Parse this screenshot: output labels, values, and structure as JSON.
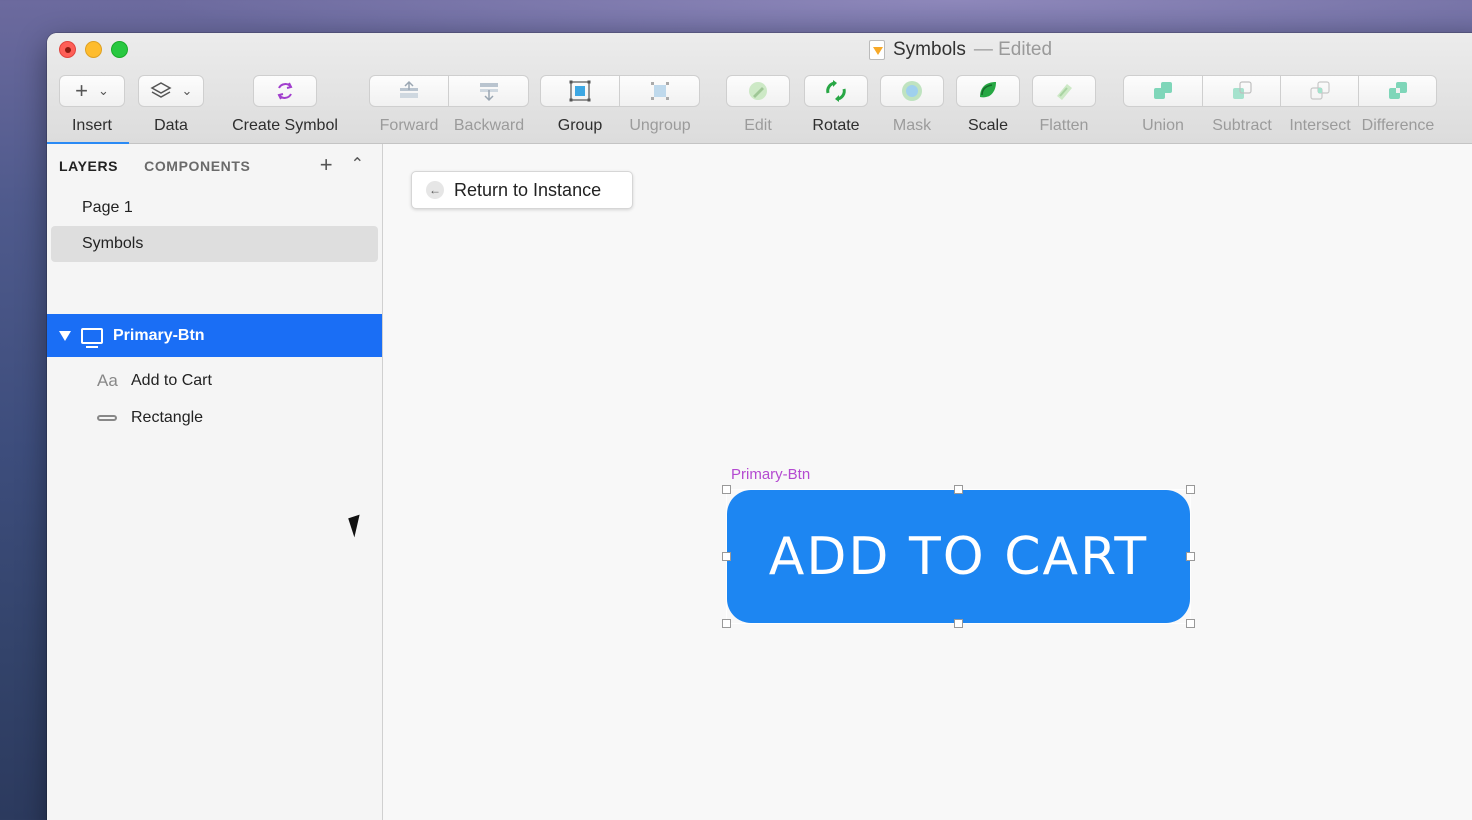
{
  "window": {
    "title": "Symbols",
    "title_status": "— Edited"
  },
  "toolbar": {
    "insert": "Insert",
    "data": "Data",
    "create_symbol": "Create Symbol",
    "forward": "Forward",
    "backward": "Backward",
    "group": "Group",
    "ungroup": "Ungroup",
    "edit": "Edit",
    "rotate": "Rotate",
    "mask": "Mask",
    "scale": "Scale",
    "flatten": "Flatten",
    "union": "Union",
    "subtract": "Subtract",
    "intersect": "Intersect",
    "difference": "Difference"
  },
  "sidebar": {
    "tabs": {
      "layers": "LAYERS",
      "components": "COMPONENTS"
    },
    "pages": [
      "Page 1",
      "Symbols"
    ],
    "selected_page": "Symbols",
    "layers": {
      "artboard": "Primary-Btn",
      "children": [
        {
          "icon": "text-layer-icon",
          "glyph": "Aa",
          "label": "Add to Cart"
        },
        {
          "icon": "rectangle-layer-icon",
          "label": "Rectangle"
        }
      ]
    }
  },
  "canvas": {
    "return_button": "Return to Instance",
    "artboard_label": "Primary-Btn",
    "button_text": "ADD TO CART",
    "button_color": "#1d86f2",
    "artboard_label_color": "#b44ad1"
  },
  "colors": {
    "accent": "#1a6ef5"
  }
}
